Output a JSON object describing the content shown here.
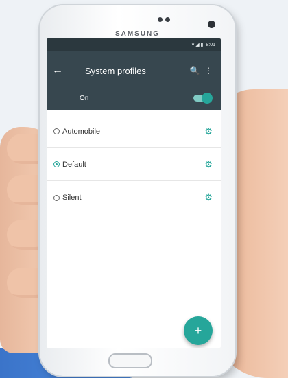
{
  "device": {
    "brand": "SAMSUNG"
  },
  "statusbar": {
    "icons": "▾ ◢ ▮",
    "time": "8:01"
  },
  "toolbar": {
    "back_icon": "←",
    "title": "System profiles",
    "search_icon": "🔍",
    "more_icon": "⋮"
  },
  "master_switch": {
    "label": "On",
    "state": "on"
  },
  "profiles": [
    {
      "label": "Automobile",
      "selected": false
    },
    {
      "label": "Default",
      "selected": true
    },
    {
      "label": "Silent",
      "selected": false
    }
  ],
  "gear_icon": "⚙",
  "fab": {
    "icon": "+"
  },
  "colors": {
    "accent": "#26a69a",
    "toolbar": "#37474f",
    "statusbar": "#2b383e"
  }
}
